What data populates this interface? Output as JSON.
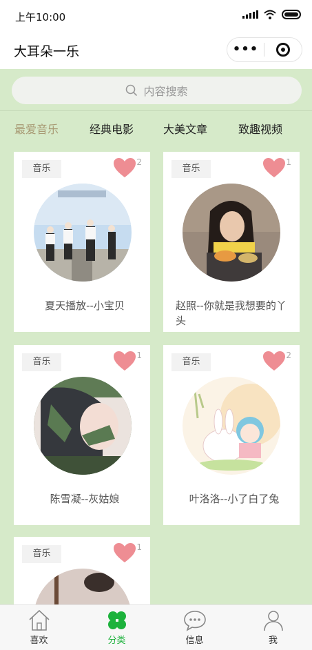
{
  "status_bar": {
    "time": "上午10:00"
  },
  "nav": {
    "title": "大耳朵一乐",
    "more": "•••"
  },
  "search": {
    "placeholder": "内容搜索"
  },
  "tabs": [
    {
      "label": "最爱音乐",
      "active": true
    },
    {
      "label": "经典电影",
      "active": false
    },
    {
      "label": "大美文章",
      "active": false
    },
    {
      "label": "致趣视频",
      "active": false
    }
  ],
  "cards": [
    {
      "tag": "音乐",
      "likes": "2",
      "caption": "夏天播放--小宝贝",
      "thumb_icon": "album-cover-group-photo"
    },
    {
      "tag": "音乐",
      "likes": "1",
      "caption": "赵照--你就是我想要的丫头",
      "thumb_icon": "album-cover-girl-portrait"
    },
    {
      "tag": "音乐",
      "likes": "1",
      "caption": "陈雪凝--灰姑娘",
      "thumb_icon": "album-cover-illustration-phone"
    },
    {
      "tag": "音乐",
      "likes": "2",
      "caption": "叶洛洛--小了白了兔",
      "thumb_icon": "album-cover-bunny-cartoon"
    },
    {
      "tag": "音乐",
      "likes": "1",
      "caption": "",
      "thumb_icon": "album-cover-guitar"
    }
  ],
  "tabbar": [
    {
      "label": "喜欢",
      "icon": "house-icon",
      "active": false
    },
    {
      "label": "分类",
      "icon": "clover-icon",
      "active": true
    },
    {
      "label": "信息",
      "icon": "chat-bubble-icon",
      "active": false
    },
    {
      "label": "我",
      "icon": "user-icon",
      "active": false
    }
  ],
  "colors": {
    "background_green": "#d6eac9",
    "active_tab": "#a89a74",
    "heart": "#ee8d93",
    "tabbar_active": "#1db23c"
  }
}
